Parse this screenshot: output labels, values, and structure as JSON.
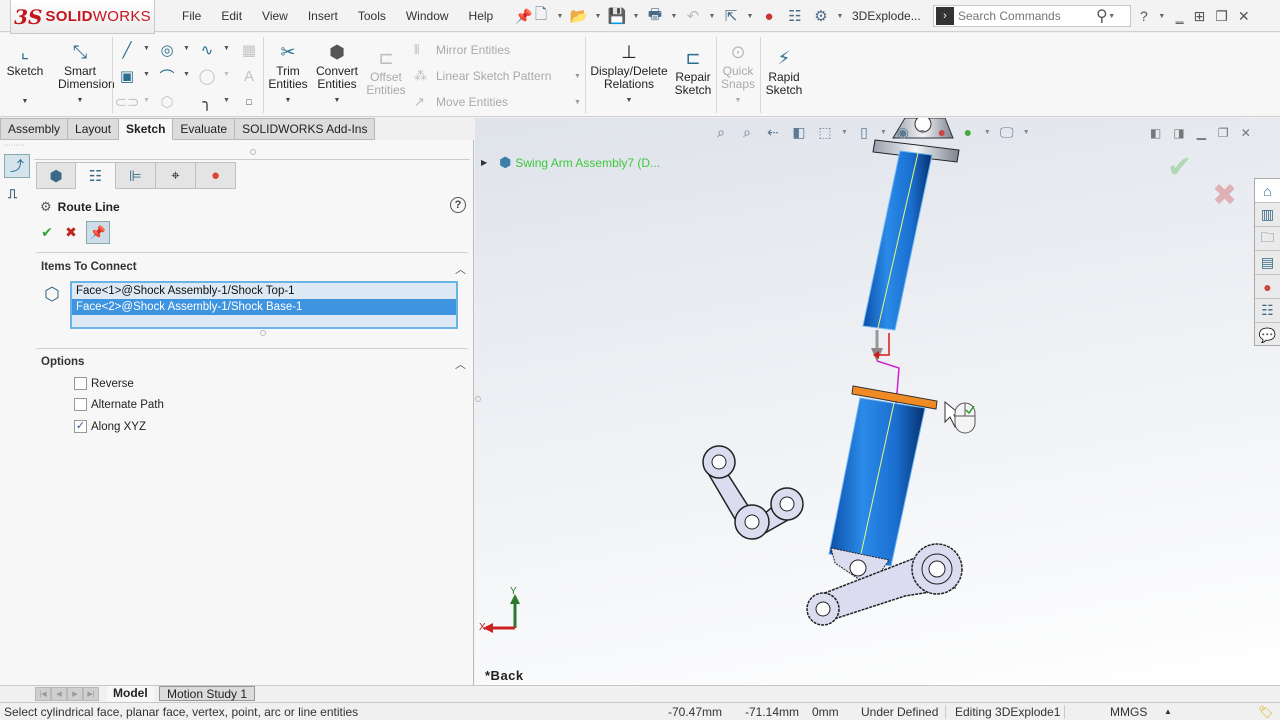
{
  "app": {
    "logo_ds": "3S",
    "logo_brand_bold": "SOLID",
    "logo_brand_light": "WORKS",
    "document_name": "3DExplode..."
  },
  "menu": [
    "File",
    "Edit",
    "View",
    "Insert",
    "Tools",
    "Window",
    "Help"
  ],
  "quick_access": {
    "icons": [
      "new-document-icon",
      "open-icon",
      "save-icon",
      "print-icon",
      "undo-icon",
      "select-icon",
      "rebuild-icon",
      "file-properties-icon",
      "options-icon"
    ]
  },
  "search": {
    "placeholder": "Search Commands",
    "help_label": "?"
  },
  "command_manager": {
    "sketch": "Sketch",
    "smart_dimension": [
      "Smart",
      "Dimension"
    ],
    "trim_entities": [
      "Trim",
      "Entities"
    ],
    "convert_entities": [
      "Convert",
      "Entities"
    ],
    "offset_entities": [
      "Offset",
      "Entities"
    ],
    "mirror_entities": "Mirror Entities",
    "linear_sketch_pattern": "Linear Sketch Pattern",
    "move_entities": "Move Entities",
    "display_delete_relations": [
      "Display/Delete",
      "Relations"
    ],
    "repair_sketch": [
      "Repair",
      "Sketch"
    ],
    "quick_snaps": [
      "Quick",
      "Snaps"
    ],
    "rapid_sketch": [
      "Rapid",
      "Sketch"
    ]
  },
  "command_tabs": [
    {
      "label": "Assembly",
      "active": false
    },
    {
      "label": "Layout",
      "active": false
    },
    {
      "label": "Sketch",
      "active": true
    },
    {
      "label": "Evaluate",
      "active": false
    },
    {
      "label": "SOLIDWORKS Add-Ins",
      "active": false
    }
  ],
  "property_manager": {
    "title": "Route Line",
    "help": "?",
    "ok": "✔",
    "cancel": "✖",
    "items_to_connect": {
      "title": "Items To Connect",
      "items": [
        {
          "label": "Face<1>@Shock Assembly-1/Shock Top-1",
          "selected": false
        },
        {
          "label": "Face<2>@Shock Assembly-1/Shock Base-1",
          "selected": true
        }
      ]
    },
    "options": {
      "title": "Options",
      "checkboxes": [
        {
          "label": "Reverse",
          "checked": false
        },
        {
          "label": "Alternate Path",
          "checked": false
        },
        {
          "label": "Along XYZ",
          "checked": true
        }
      ]
    }
  },
  "viewport": {
    "tree_flyout": "Swing Arm Assembly7  (D...",
    "view_name": "*Back",
    "triad_x": "X",
    "triad_y": "Y",
    "colors": {
      "shock_body": "#1a6fd0",
      "route_line": "#d01fd0",
      "selected_face": "#f08a24",
      "link_fill": "#dcdcf0"
    }
  },
  "task_pane": [
    "home-icon",
    "design-library-icon",
    "file-explorer-icon",
    "view-palette-icon",
    "appearances-icon",
    "custom-properties-icon",
    "forum-icon"
  ],
  "bottom_tabs": [
    {
      "label": "Model",
      "active": true
    },
    {
      "label": "Motion Study 1",
      "active": false
    }
  ],
  "status_bar": {
    "message": "Select cylindrical face, planar face, vertex, point, arc or line entities",
    "x": "-70.47mm",
    "y": "-71.14mm",
    "z": "0mm",
    "sketch_state": "Under Defined",
    "editing": "Editing 3DExplode1",
    "units": "MMGS",
    "units_arrow": "▲"
  }
}
